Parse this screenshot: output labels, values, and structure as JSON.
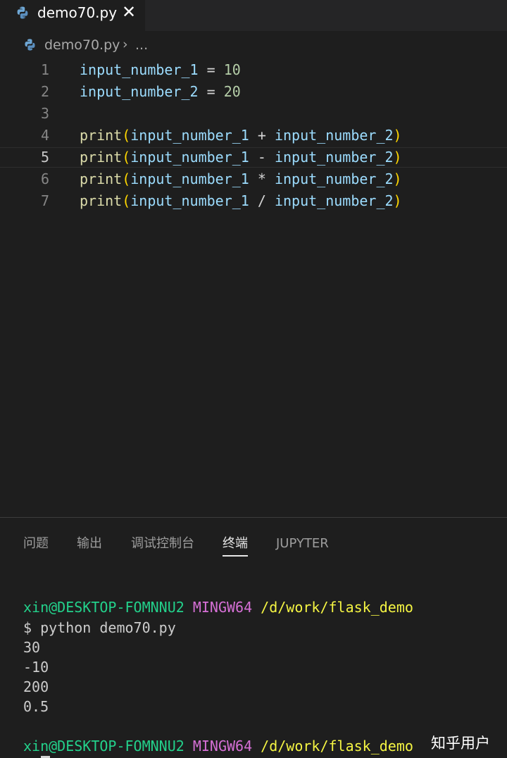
{
  "tab": {
    "filename": "demo70.py",
    "close_glyph": "✕"
  },
  "breadcrumb": {
    "file": "demo70.py",
    "separator": "›",
    "more": "..."
  },
  "editor": {
    "active_line": 5,
    "lines": [
      {
        "n": "1",
        "tokens": [
          [
            "var",
            "input_number_1"
          ],
          [
            "op",
            " = "
          ],
          [
            "num",
            "10"
          ]
        ]
      },
      {
        "n": "2",
        "tokens": [
          [
            "var",
            "input_number_2"
          ],
          [
            "op",
            " = "
          ],
          [
            "num",
            "20"
          ]
        ]
      },
      {
        "n": "3",
        "tokens": []
      },
      {
        "n": "4",
        "tokens": [
          [
            "fn",
            "print"
          ],
          [
            "par",
            "("
          ],
          [
            "var",
            "input_number_1"
          ],
          [
            "op",
            " + "
          ],
          [
            "var",
            "input_number_2"
          ],
          [
            "par",
            ")"
          ]
        ]
      },
      {
        "n": "5",
        "tokens": [
          [
            "fn",
            "print"
          ],
          [
            "par",
            "("
          ],
          [
            "var",
            "input_number_1"
          ],
          [
            "op",
            " - "
          ],
          [
            "var",
            "input_number_2"
          ],
          [
            "par",
            ")"
          ]
        ]
      },
      {
        "n": "6",
        "tokens": [
          [
            "fn",
            "print"
          ],
          [
            "par",
            "("
          ],
          [
            "var",
            "input_number_1"
          ],
          [
            "op",
            " * "
          ],
          [
            "var",
            "input_number_2"
          ],
          [
            "par",
            ")"
          ]
        ]
      },
      {
        "n": "7",
        "tokens": [
          [
            "fn",
            "print"
          ],
          [
            "par",
            "("
          ],
          [
            "var",
            "input_number_1"
          ],
          [
            "op",
            " / "
          ],
          [
            "var",
            "input_number_2"
          ],
          [
            "par",
            ")"
          ]
        ]
      }
    ]
  },
  "panel": {
    "tabs": [
      "问题",
      "输出",
      "调试控制台",
      "终端",
      "JUPYTER"
    ],
    "active_tab": "终端"
  },
  "terminal": {
    "prompt": {
      "user": "xin@DESKTOP-FOMNNU2",
      "env": "MINGW64",
      "path": "/d/work/flask_demo"
    },
    "command": "$ python demo70.py",
    "outputs": [
      "30",
      "-10",
      "200",
      "0.5"
    ],
    "prompt2": {
      "user": "xin@DESKTOP-FOMNNU2",
      "env": "MINGW64",
      "path": "/d/work/flask_demo"
    }
  },
  "watermark": "知乎用户",
  "colors": {
    "variable": "#9cdcfe",
    "number": "#b5cea8",
    "function": "#dcdcaa",
    "bracket": "#ffd700",
    "term_user": "#23d18b",
    "term_env": "#d670d6",
    "term_path": "#f5f543"
  },
  "icons": {
    "file_type": "python-icon",
    "close": "close-icon"
  }
}
